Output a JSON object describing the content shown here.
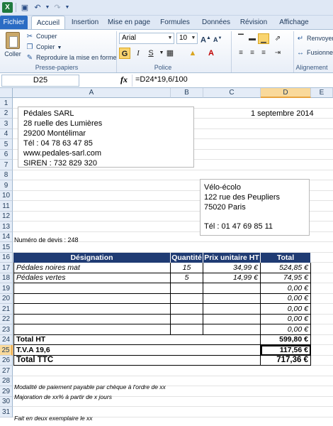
{
  "quick_access": {
    "app_icon": "excel-icon",
    "save_icon": "save-icon",
    "undo_icon": "undo-icon",
    "redo_icon": "redo-icon"
  },
  "ribbon": {
    "tabs": [
      "Fichier",
      "Accueil",
      "Insertion",
      "Mise en page",
      "Formules",
      "Données",
      "Révision",
      "Affichage"
    ],
    "clipboard": {
      "paste": "Coller",
      "cut": "Couper",
      "copy": "Copier",
      "format_painter": "Reproduire la mise en forme",
      "label": "Presse-papiers"
    },
    "font": {
      "name": "Arial",
      "size": "10",
      "label": "Police",
      "bold": "G",
      "italic": "I",
      "underline": "S"
    },
    "alignment": {
      "wrap": "Renvoyer",
      "merge": "Fusionne",
      "label": "Alignement"
    }
  },
  "formula_bar": {
    "name_box": "D25",
    "fx": "fx",
    "formula": "=D24*19,6/100"
  },
  "columns": [
    "A",
    "B",
    "C",
    "D",
    "E"
  ],
  "rows": [
    "1",
    "2",
    "3",
    "4",
    "5",
    "6",
    "7",
    "8",
    "9",
    "10",
    "11",
    "12",
    "13",
    "14",
    "15",
    "16",
    "17",
    "18",
    "19",
    "20",
    "21",
    "22",
    "23",
    "24",
    "25",
    "26",
    "27",
    "28",
    "29",
    "30",
    "31"
  ],
  "sender": {
    "name": "Pédales SARL",
    "street": "28 ruelle des Lumières",
    "city": "29200  Montélimar",
    "tel": "Tél : 04 78 63 47 85",
    "web": "www.pedales-sarl.com",
    "siren": "SIREN : 732 829 320"
  },
  "date": "1 septembre 2014",
  "recipient": {
    "name": "Vélo-écolo",
    "street": "122 rue des Peupliers",
    "city": "75020  Paris",
    "tel": "Tél : 01 47 69 85 11"
  },
  "quote_number": "Numéro de devis : 248",
  "table": {
    "headers": [
      "Désignation",
      "Quantité",
      "Prix unitaire HT",
      "Total"
    ],
    "rows": [
      [
        "Pédales noires mat",
        "15",
        "34,99 €",
        "524,85 €"
      ],
      [
        "Pédales vertes",
        "5",
        "14,99 €",
        "74,95 €"
      ],
      [
        "",
        "",
        "",
        "0,00 €"
      ],
      [
        "",
        "",
        "",
        "0,00 €"
      ],
      [
        "",
        "",
        "",
        "0,00 €"
      ],
      [
        "",
        "",
        "",
        "0,00 €"
      ],
      [
        "",
        "",
        "",
        "0,00 €"
      ]
    ],
    "total_ht_label": "Total HT",
    "total_ht": "599,80 €",
    "tva_label": "T.V.A 19,6",
    "tva": "117,56 €",
    "total_ttc_label": "Total TTC",
    "total_ttc": "717,36 €"
  },
  "notes": {
    "payment": "Modalité de paiement payable par chèque à l'ordre de xx",
    "surcharge": "Majoration de xx% à partir de x jours",
    "copies": "Fait en deux exemplaire le xx"
  }
}
